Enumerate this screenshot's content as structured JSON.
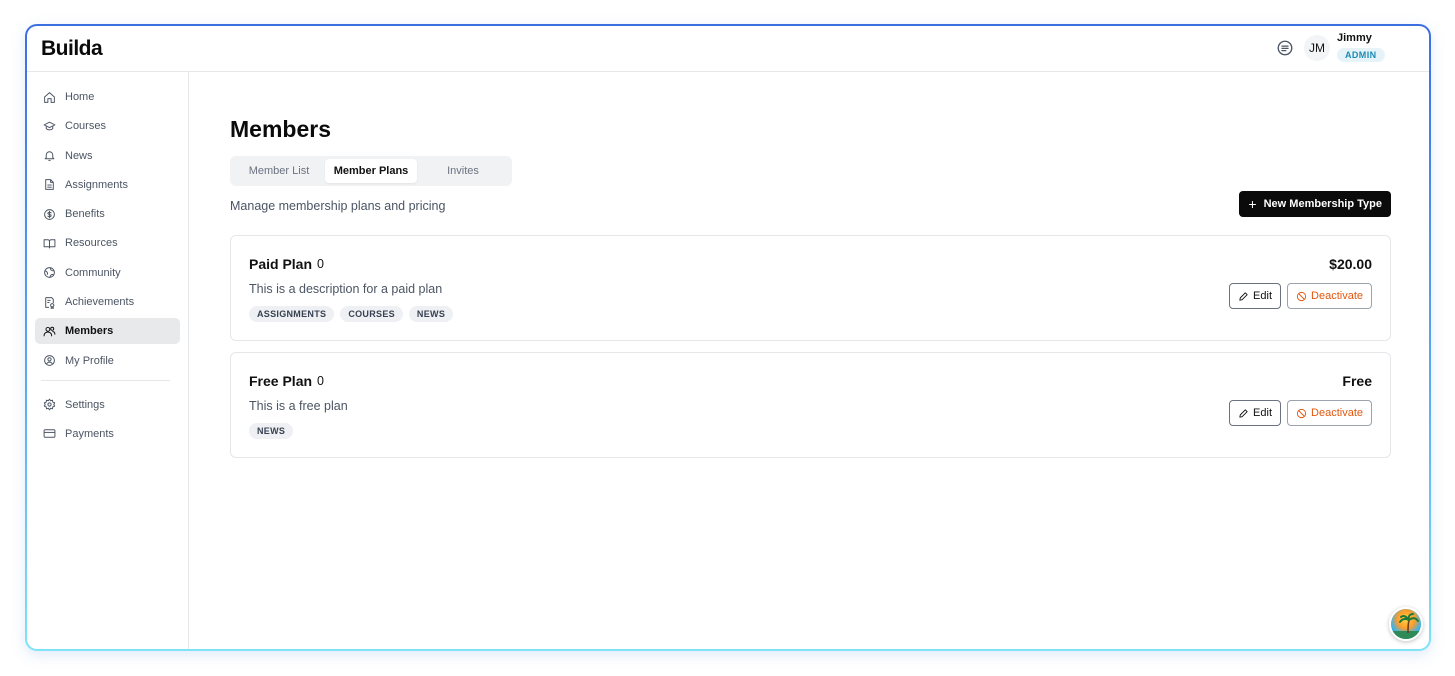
{
  "app": {
    "name": "Builda"
  },
  "user": {
    "initials": "JM",
    "name": "Jimmy",
    "role": "ADMIN"
  },
  "sidebar": {
    "items": [
      {
        "label": "Home",
        "icon": "home-icon"
      },
      {
        "label": "Courses",
        "icon": "graduation-cap-icon"
      },
      {
        "label": "News",
        "icon": "bell-icon"
      },
      {
        "label": "Assignments",
        "icon": "file-text-icon"
      },
      {
        "label": "Benefits",
        "icon": "dollar-circle-icon"
      },
      {
        "label": "Resources",
        "icon": "book-open-icon"
      },
      {
        "label": "Community",
        "icon": "globe-icon"
      },
      {
        "label": "Achievements",
        "icon": "award-icon"
      },
      {
        "label": "Members",
        "icon": "users-icon",
        "active": true
      },
      {
        "label": "My Profile",
        "icon": "user-circle-icon"
      }
    ],
    "secondary": [
      {
        "label": "Settings",
        "icon": "gear-icon"
      },
      {
        "label": "Payments",
        "icon": "credit-card-icon"
      }
    ]
  },
  "main": {
    "title": "Members",
    "tabs": [
      {
        "label": "Member List",
        "active": false
      },
      {
        "label": "Member Plans",
        "active": true
      },
      {
        "label": "Invites",
        "active": false
      }
    ],
    "subtitle": "Manage membership plans and pricing",
    "new_button_label": "New Membership Type",
    "plans": [
      {
        "name": "Paid Plan",
        "member_count": "0",
        "description": "This is a description for a paid plan",
        "tags": [
          "ASSIGNMENTS",
          "COURSES",
          "NEWS"
        ],
        "price": "$20.00",
        "edit_label": "Edit",
        "deactivate_label": "Deactivate"
      },
      {
        "name": "Free Plan",
        "member_count": "0",
        "description": "This is a free plan",
        "tags": [
          "NEWS"
        ],
        "price": "Free",
        "edit_label": "Edit",
        "deactivate_label": "Deactivate"
      }
    ]
  },
  "colors": {
    "accent": "#0b0b0b",
    "admin_badge_bg": "#e6f4f9",
    "admin_badge_text": "#1b8ab4",
    "deactivate": "#e2570e",
    "frame_gradient_top": "#3b6fe0",
    "frame_gradient_bottom": "#7fe3f5"
  }
}
